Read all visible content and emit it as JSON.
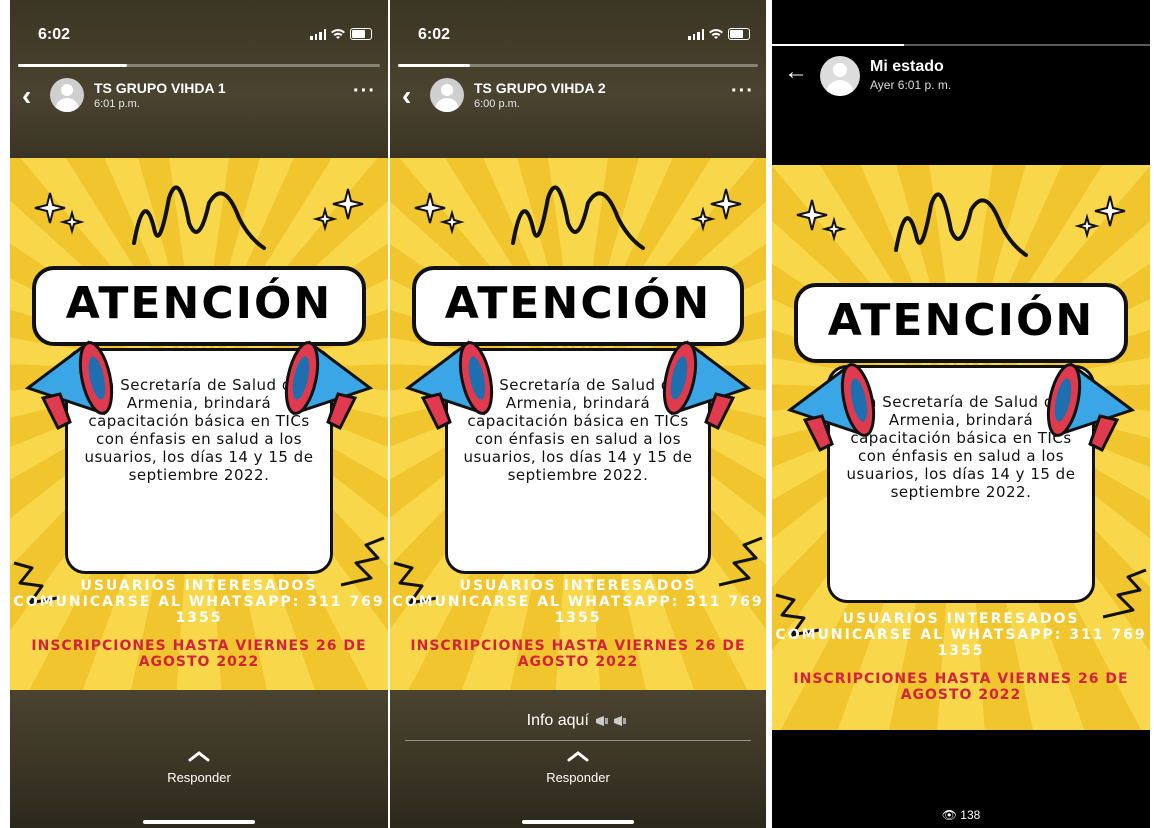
{
  "panels": [
    {
      "status_time": "6:02",
      "contact_name": "TS GRUPO VIHDA 1",
      "contact_time": "6:01 p.m.",
      "caption": "",
      "reply_label": "Responder",
      "progress": 0.3
    },
    {
      "status_time": "6:02",
      "contact_name": "TS GRUPO VIHDA 2",
      "contact_time": "6:00 p.m.",
      "caption": "Info aquí",
      "reply_label": "Responder",
      "progress": 0.2
    },
    {
      "contact_name": "Mi estado",
      "contact_time": "Ayer 6:01 p. m.",
      "views": "138",
      "progress": 0.35
    }
  ],
  "poster": {
    "heading": "ATENCIÓN",
    "message": "La Secretaría de Salud de Armenia, brindará capacitación básica en TICs con énfasis en salud a los usuarios, los días 14 y 15 de septiembre 2022.",
    "users_line": "USUARIOS INTERESADOS COMUNICARSE AL WHATSAPP: 311 769 1355",
    "inscriptions_line": "INSCRIPCIONES HASTA VIERNES 26 DE AGOSTO 2022"
  },
  "colors": {
    "poster_yellow": "#f8d84a",
    "poster_red": "#d3233c",
    "megaphone_blue": "#3aa6e6"
  }
}
